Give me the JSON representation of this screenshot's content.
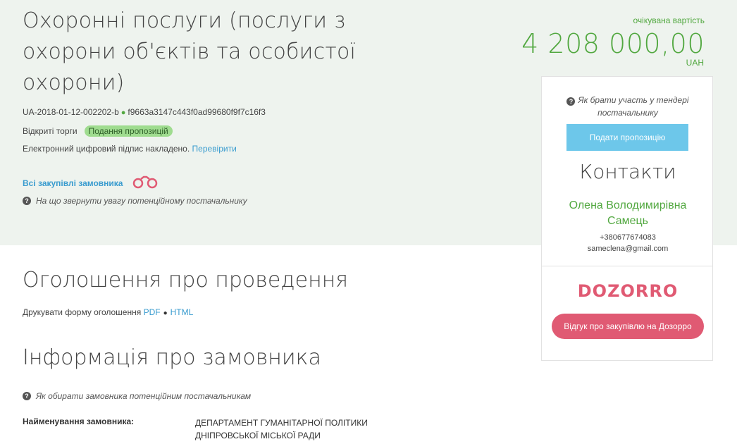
{
  "tender": {
    "title": "Охоронні послуги (послуги з охорони об'єктів та особистої охорони)",
    "id": "UA-2018-01-12-002202-b",
    "hash": "f9663a3147c443f0ad99680f9f7c16f3",
    "procedure": "Відкриті торги",
    "status": "Подання пропозицій",
    "signature_text": "Електронний цифровий підпис накладено.",
    "signature_link": "Перевірити",
    "all_purchases_link": "Всі закупівлі замовника",
    "attention_hint": "На що звернути увагу потенційному постачальнику"
  },
  "price": {
    "label": "очікувана вартість",
    "amount": "4 208 000,00",
    "currency": "UAH"
  },
  "panel": {
    "participate_hint": "Як брати участь у тендері постачальнику",
    "submit_button": "Подати пропозицію",
    "contacts_title": "Контакти",
    "contact_name": "Олена Володимирівна Самець",
    "phone": "+380677674083",
    "email": "sameclena@gmail.com",
    "dozorro_logo": "DOZORRO",
    "dozorro_button": "Відгук про закупівлю на Дозорро"
  },
  "announcement": {
    "title": "Оголошення про проведення",
    "print_label": "Друкувати форму оголошення",
    "pdf": "PDF",
    "html": "HTML"
  },
  "customer": {
    "title": "Інформація про замовника",
    "hint": "Як обирати замовника потенційним постачальникам",
    "name_label": "Найменування замовника:",
    "name_value": "ДЕПАРТАМЕНТ ГУМАНІТАРНОЇ ПОЛІТИКИ ДНІПРОВСЬКОЇ МІСЬКОЇ РАДИ"
  },
  "colors": {
    "accent_green": "#52a840",
    "link_blue": "#3a9ccf",
    "button_blue": "#6dc7ea",
    "dozorro_pink": "#e05a73",
    "hero_bg": "#eef3ee"
  },
  "icons": {
    "question": "question-circle-icon",
    "binoculars": "binoculars-icon"
  }
}
